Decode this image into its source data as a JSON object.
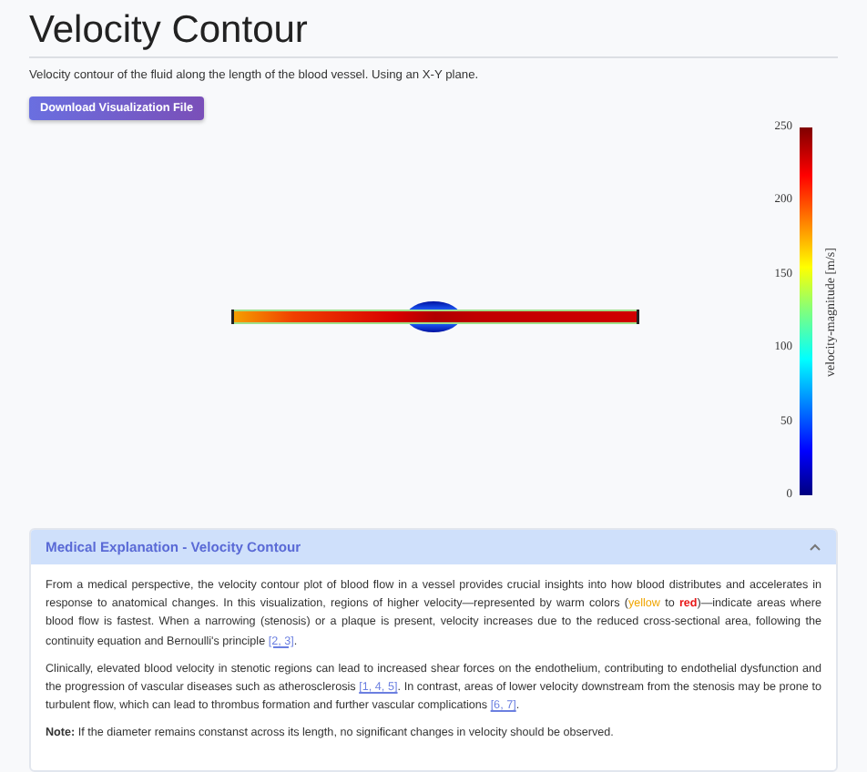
{
  "title": "Velocity Contour",
  "subtitle": "Velocity contour of the fluid along the length of the blood vessel. Using an X-Y plane.",
  "download_button": "Download Visualization File",
  "colorbar": {
    "label": "velocity-magnitude [m/s]",
    "ticks": [
      "250",
      "200",
      "150",
      "100",
      "50",
      "0"
    ]
  },
  "explanation": {
    "title": "Medical Explanation - Velocity Contour",
    "expanded": true,
    "paragraphs": [
      [
        {
          "kind": "text",
          "text": "From a medical perspective, the velocity contour plot of blood flow in a vessel provides crucial insights into how blood distributes and accelerates in response to anatomical changes. In this visualization, regions of higher velocity—represented by warm colors ("
        },
        {
          "kind": "color",
          "text": "yellow",
          "color": "#f0a500"
        },
        {
          "kind": "text",
          "text": " to "
        },
        {
          "kind": "color",
          "text": "red",
          "color": "#e81818"
        },
        {
          "kind": "text",
          "text": ")—indicate areas where blood flow is fastest. When a narrowing (stenosis) or a plaque is present, velocity increases due to the reduced cross-sectional area, following the continuity equation and Bernoulli's principle "
        },
        {
          "kind": "link",
          "text": "[2, 3]"
        },
        {
          "kind": "text",
          "text": "."
        }
      ],
      [
        {
          "kind": "text",
          "text": "Clinically, elevated blood velocity in stenotic regions can lead to increased shear forces on the endothelium, contributing to endothelial dysfunction and the progression of vascular diseases such as atherosclerosis "
        },
        {
          "kind": "link",
          "text": "[1, 4, 5]"
        },
        {
          "kind": "text",
          "text": ". In contrast, areas of lower velocity downstream from the stenosis may be prone to turbulent flow, which can lead to thrombus formation and further vascular complications "
        },
        {
          "kind": "link",
          "text": "[6, 7]"
        },
        {
          "kind": "text",
          "text": "."
        }
      ]
    ],
    "note": "**Note:** If the diameter remains constanst across its length, no significant changes in velocity should be observed."
  }
}
